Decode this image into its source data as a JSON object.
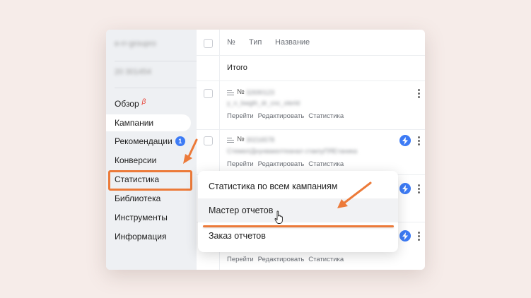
{
  "sidebar": {
    "account": [
      "e-rr-groupro",
      "20 301454"
    ],
    "items": [
      {
        "label": "Обзор",
        "beta": "β"
      },
      {
        "label": "Кампании"
      },
      {
        "label": "Рекомендации",
        "badge": "1"
      },
      {
        "label": "Конверсии"
      },
      {
        "label": "Статистика"
      },
      {
        "label": "Библиотека"
      },
      {
        "label": "Инструменты"
      },
      {
        "label": "Информация"
      }
    ]
  },
  "table": {
    "headers": [
      "№",
      "Тип",
      "Название"
    ],
    "total_label": "Итого",
    "rows": [
      {
        "num_prefix": "№",
        "id": "32690123",
        "name": "y_n_bwgth_dr_cnc_oterld",
        "actions": [
          "Перейти",
          "Редактировать",
          "Статистика"
        ]
      },
      {
        "num_prefix": "№",
        "id": "30216578",
        "name": "Стемел/Днунвакелтеанал стакпуПЯЕтаника",
        "actions": [
          "Перейти",
          "Редактировать",
          "Статистика"
        ]
      },
      {
        "num_prefix": "№",
        "id": "",
        "name": "",
        "actions": [
          "Перейти",
          "Редактировать",
          "Статистика"
        ]
      },
      {
        "num_prefix": "№",
        "id": "",
        "name": "",
        "actions": [
          "Перейти",
          "Редактировать",
          "Статистика"
        ]
      }
    ]
  },
  "dropdown": {
    "items": [
      "Статистика по всем кампаниям",
      "Мастер отчетов",
      "Заказ отчетов"
    ]
  },
  "colors": {
    "annotation": "#ec7a39",
    "accent": "#3d7bf5",
    "beta": "#e8473b",
    "page_background": "#f6ece9"
  }
}
